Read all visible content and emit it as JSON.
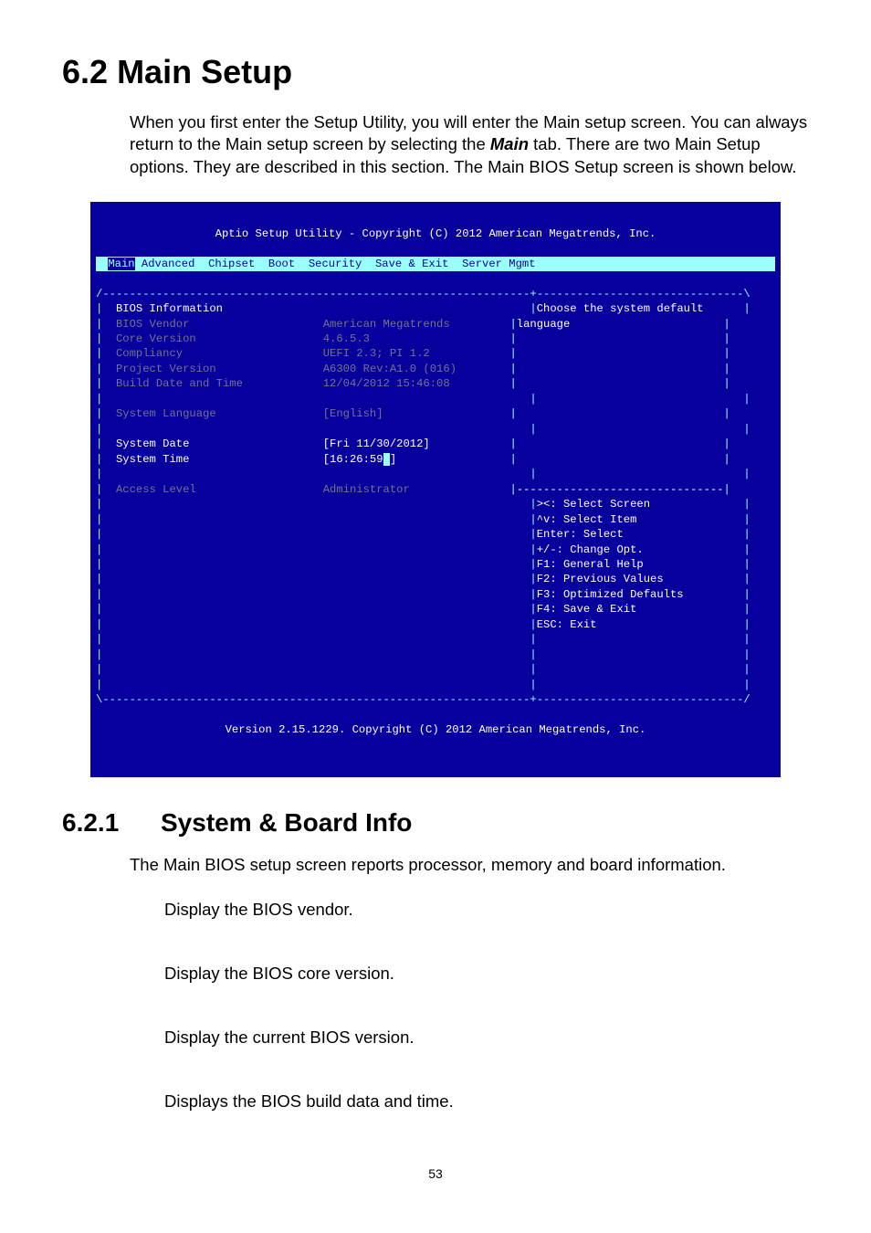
{
  "section": {
    "number": "6.2",
    "title": "Main Setup",
    "intro_1": "When you first enter the Setup Utility, you will enter the Main setup screen. You can always return to the Main setup screen by selecting the ",
    "intro_tab": "Main",
    "intro_2": " tab. There are two Main Setup options. They are described in this section. The Main BIOS Setup screen is shown below."
  },
  "bios": {
    "header": "Aptio Setup Utility - Copyright (C) 2012 American Megatrends, Inc.",
    "tabs": [
      "Main",
      "Advanced",
      "Chipset",
      "Boot",
      "Security",
      "Save & Exit",
      "Server Mgmt"
    ],
    "top_border": "/----------------------------------------------------------------+-------------------------------\\",
    "rows": {
      "bios_info_label": "BIOS Information",
      "help_line1": "Choose the system default",
      "help_line2": "language",
      "vendor_label": "BIOS Vendor",
      "vendor_value": "American Megatrends",
      "core_label": "Core Version",
      "core_value": "4.6.5.3",
      "comp_label": "Compliancy",
      "comp_value": "UEFI 2.3; PI 1.2",
      "proj_label": "Project Version",
      "proj_value": "A6300 Rev:A1.0 (016)",
      "build_label": "Build Date and Time",
      "build_value": "12/04/2012 15:46:08",
      "lang_label": "System Language",
      "lang_value": "[English]",
      "date_label": "System Date",
      "date_value": "[Fri 11/30/2012]",
      "time_label": "System Time",
      "time_value": "[16:26:59",
      "time_close": "]",
      "access_label": "Access Level",
      "access_value": "Administrator"
    },
    "help_divider": "-------------------------------",
    "help_keys": [
      "><: Select Screen",
      "^v: Select Item",
      "Enter: Select",
      "+/-: Change Opt.",
      "F1: General Help",
      "F2: Previous Values",
      "F3: Optimized Defaults",
      "F4: Save & Exit",
      "ESC: Exit"
    ],
    "bottom_border": "\\----------------------------------------------------------------+-------------------------------/",
    "footer": "Version 2.15.1229. Copyright (C) 2012 American Megatrends, Inc."
  },
  "subsection": {
    "number": "6.2.1",
    "title": "System & Board Info",
    "intro": "The Main BIOS setup screen reports processor, memory and board information.",
    "items": [
      "Display the BIOS vendor.",
      "Display the BIOS core version.",
      "Display the current BIOS version.",
      "Displays the BIOS build data and time."
    ]
  },
  "page_number": "53"
}
